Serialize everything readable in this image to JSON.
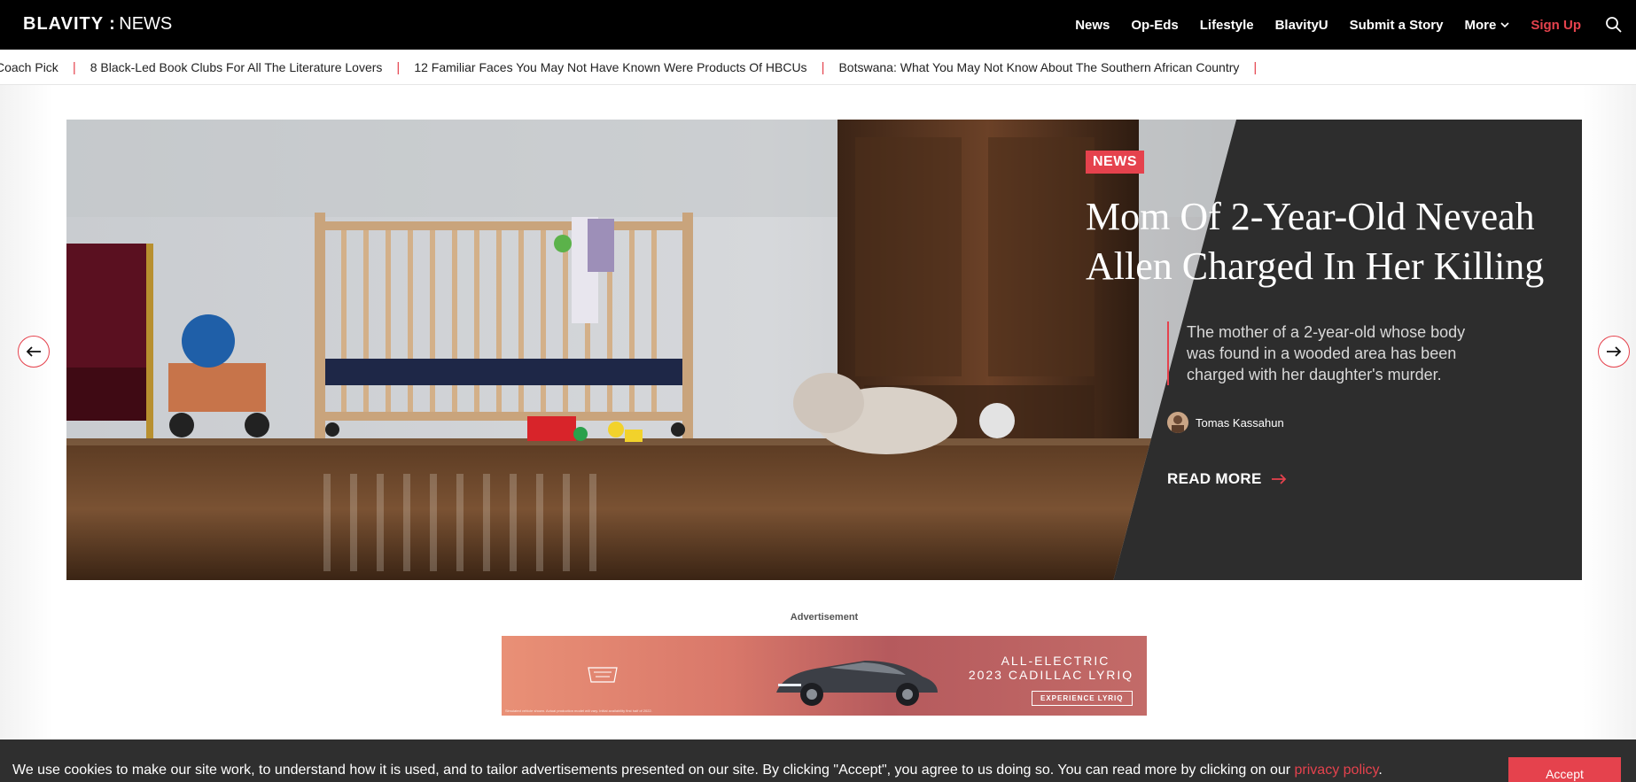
{
  "header": {
    "brand": "BLAVITY",
    "separator": ":",
    "section": "NEWS",
    "nav": [
      "News",
      "Op-Eds",
      "Lifestyle",
      "BlavityU",
      "Submit a Story",
      "More"
    ],
    "signup": "Sign Up"
  },
  "ticker": {
    "items": [
      "Coach Pick",
      "8 Black-Led Book Clubs For All The Literature Lovers",
      "12 Familiar Faces You May Not Have Known Were Products Of HBCUs",
      "Botswana: What You May Not Know About The Southern African Country"
    ]
  },
  "hero": {
    "category": "NEWS",
    "headline": "Mom Of 2-Year-Old Neveah Allen Charged In Her Killing",
    "excerpt": "The mother of a 2-year-old whose body was found in a wooded area has been charged with her daughter's murder.",
    "author": "Tomas Kassahun",
    "read_more": "READ MORE"
  },
  "ad": {
    "label": "Advertisement",
    "line1": "ALL-ELECTRIC",
    "line2": "2023 CADILLAC LYRIQ",
    "cta": "EXPERIENCE LYRIQ",
    "fine_print": "Simulated vehicle shown. Actual production model will vary. Initial availability first half of 2022."
  },
  "cookie": {
    "text": "We use cookies to make our site work, to understand how it is used, and to tailor advertisements presented on our site. By clicking \"Accept\", you agree to us doing so. You can read more by clicking on our ",
    "link": "privacy policy",
    "end": ".",
    "accept": "Accept"
  },
  "colors": {
    "accent": "#e5424d",
    "nav_bg": "#000000",
    "hero_panel": "#2d2d2d",
    "cookie_bg": "#2f2f2f"
  },
  "icons": [
    "search-icon",
    "chevron-down-icon",
    "arrow-left-icon",
    "arrow-right-icon",
    "cadillac-logo"
  ]
}
